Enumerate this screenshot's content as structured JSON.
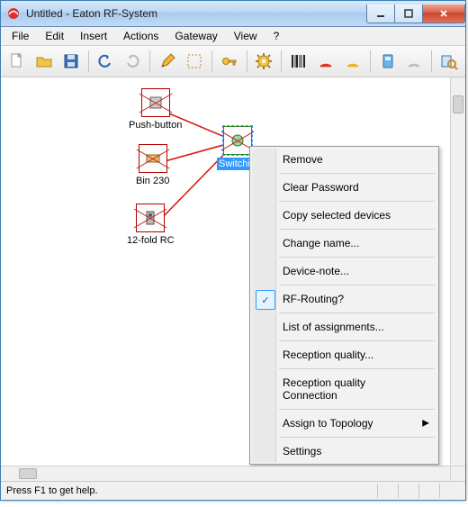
{
  "window": {
    "title": "Untitled - Eaton RF-System"
  },
  "menu": {
    "items": [
      "File",
      "Edit",
      "Insert",
      "Actions",
      "Gateway",
      "View",
      "?"
    ]
  },
  "toolbar": {
    "buttons": [
      {
        "name": "new-icon"
      },
      {
        "name": "open-icon"
      },
      {
        "name": "save-icon"
      },
      {
        "sep": true
      },
      {
        "name": "undo-icon"
      },
      {
        "name": "redo-icon"
      },
      {
        "sep": true
      },
      {
        "name": "pencil-icon"
      },
      {
        "name": "select-area-icon"
      },
      {
        "sep": true
      },
      {
        "name": "key-icon"
      },
      {
        "sep": true
      },
      {
        "name": "gear-icon"
      },
      {
        "sep": true
      },
      {
        "name": "barcode-icon"
      },
      {
        "name": "rf-red-icon"
      },
      {
        "name": "rf-yellow-icon"
      },
      {
        "sep": true
      },
      {
        "name": "device-blue-icon"
      },
      {
        "name": "rf-gray-icon"
      },
      {
        "sep": true
      },
      {
        "name": "search-device-icon"
      }
    ]
  },
  "nodes": {
    "push_button": {
      "label": "Push-button"
    },
    "bin230": {
      "label": "Bin 230"
    },
    "twelve_fold": {
      "label": "12-fold RC"
    },
    "switch_actuator": {
      "label": "Switching actuat"
    }
  },
  "context_menu": {
    "remove": "Remove",
    "clear_password": "Clear Password",
    "copy_selected": "Copy selected devices",
    "change_name": "Change name...",
    "device_note": "Device-note...",
    "rf_routing": "RF-Routing?",
    "list_assignments": "List of assignments...",
    "reception_quality": "Reception quality...",
    "reception_quality_conn_l1": "Reception quality",
    "reception_quality_conn_l2": "Connection",
    "assign_topology": "Assign to Topology",
    "settings": "Settings"
  },
  "statusbar": {
    "hint": "Press F1 to get help."
  },
  "colors": {
    "link": "#d31a1a",
    "selection": "#3399ff"
  }
}
